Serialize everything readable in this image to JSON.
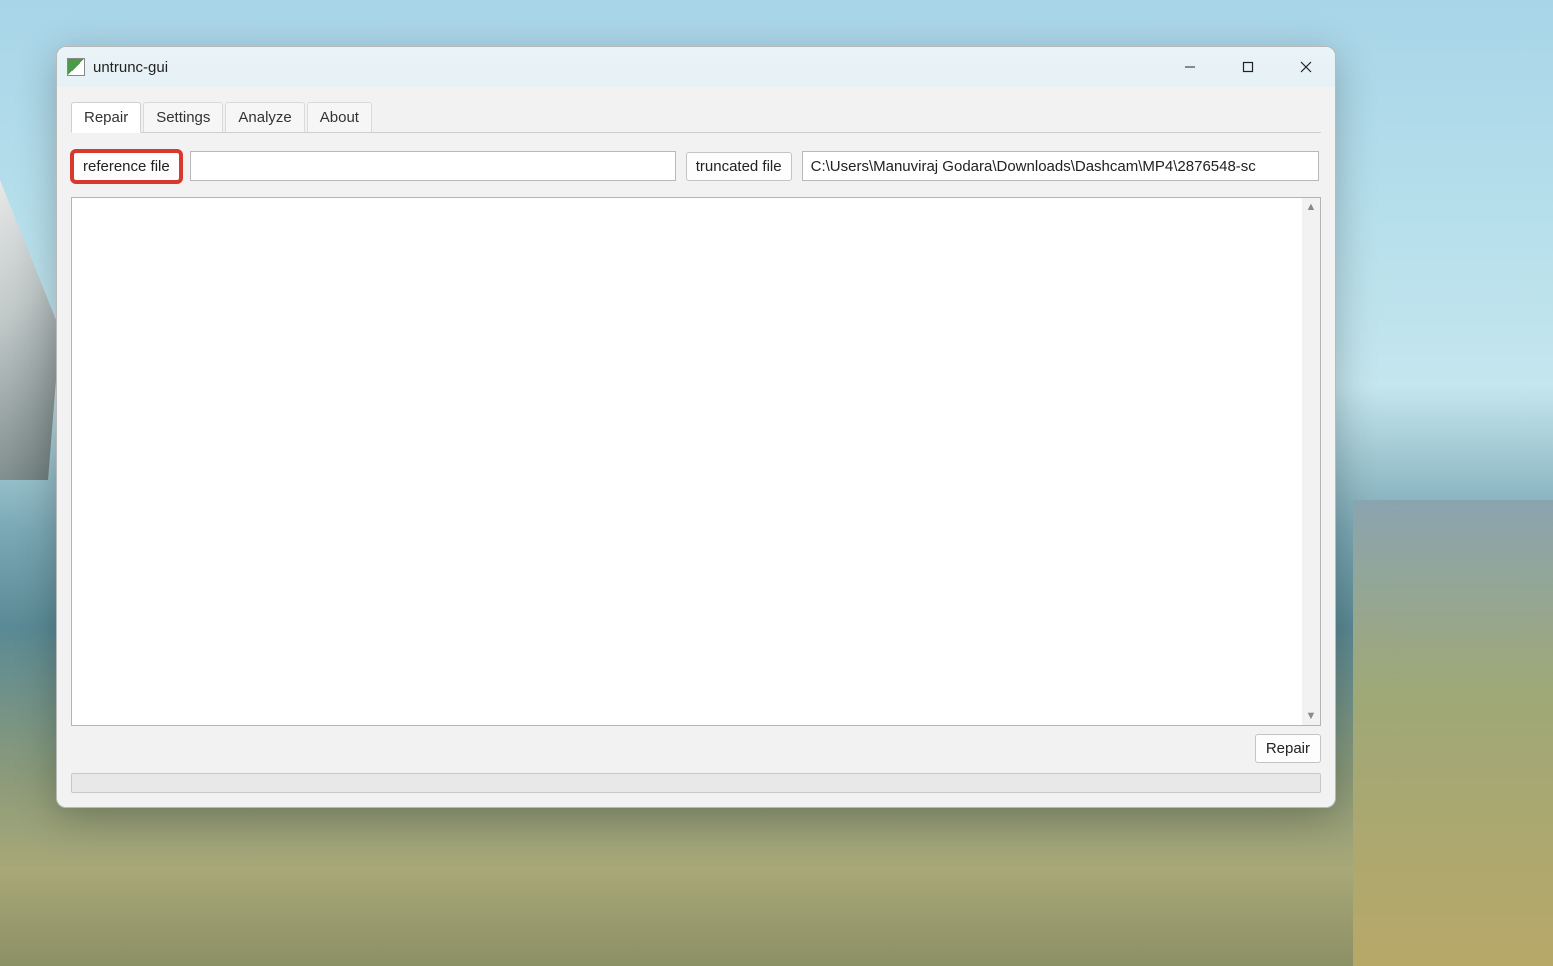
{
  "window": {
    "title": "untrunc-gui"
  },
  "tabs": [
    {
      "label": "Repair",
      "active": true
    },
    {
      "label": "Settings",
      "active": false
    },
    {
      "label": "Analyze",
      "active": false
    },
    {
      "label": "About",
      "active": false
    }
  ],
  "file_buttons": {
    "reference_label": "reference file",
    "truncated_label": "truncated file"
  },
  "inputs": {
    "reference_value": "",
    "truncated_value": "C:\\Users\\Manuviraj Godara\\Downloads\\Dashcam\\MP4\\2876548-sc"
  },
  "log_text": "",
  "repair_button_label": "Repair",
  "highlight": {
    "target": "reference-file-button"
  }
}
